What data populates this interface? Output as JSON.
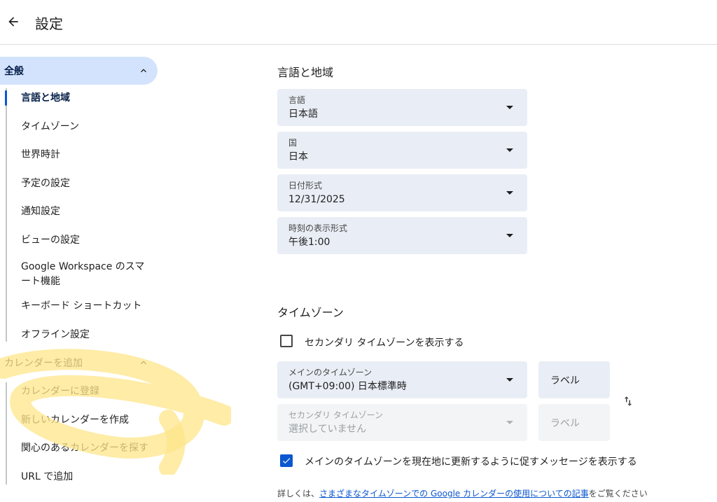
{
  "header": {
    "title": "設定",
    "back_icon": "arrow-back-icon"
  },
  "sidebar": {
    "general": {
      "label": "全般",
      "expanded": true
    },
    "general_items": [
      {
        "label": "言語と地域",
        "selected": true
      },
      {
        "label": "タイムゾーン"
      },
      {
        "label": "世界時計"
      },
      {
        "label": "予定の設定"
      },
      {
        "label": "通知設定"
      },
      {
        "label": "ビューの設定"
      },
      {
        "label": "Google Workspace のスマート機能"
      },
      {
        "label": "キーボード ショートカット"
      },
      {
        "label": "オフライン設定"
      }
    ],
    "add_calendar": {
      "label": "カレンダーを追加",
      "expanded": true
    },
    "add_items": [
      {
        "label": "カレンダーに登録"
      },
      {
        "label": "新しいカレンダーを作成"
      },
      {
        "label": "関心のあるカレンダーを探す"
      },
      {
        "label": "URL で追加"
      }
    ]
  },
  "language_region": {
    "title": "言語と地域",
    "language": {
      "label": "言語",
      "value": "日本語"
    },
    "country": {
      "label": "国",
      "value": "日本"
    },
    "date_format": {
      "label": "日付形式",
      "value": "12/31/2025"
    },
    "time_format": {
      "label": "時刻の表示形式",
      "value": "午後1:00"
    }
  },
  "timezone": {
    "title": "タイムゾーン",
    "show_secondary": {
      "label": "セカンダリ タイムゾーンを表示する",
      "checked": false
    },
    "primary": {
      "label": "メインのタイムゾーン",
      "value": "(GMT+09:00) 日本標準時",
      "label_button": "ラベル"
    },
    "secondary": {
      "label": "セカンダリ タイムゾーン",
      "value": "選択していません",
      "label_button": "ラベル"
    },
    "prompt_update": {
      "label": "メインのタイムゾーンを現在地に更新するように促すメッセージを表示する",
      "checked": true
    },
    "info_prefix": "詳しくは、",
    "info_link": "さまざまなタイムゾーンでの Google カレンダーの使用についての記事",
    "info_suffix": "をご覧ください"
  },
  "colors": {
    "accent": "#0b57d0",
    "active_bg": "#d3e3fd",
    "field_bg": "#e9eef6",
    "highlight": "#fde68a"
  }
}
